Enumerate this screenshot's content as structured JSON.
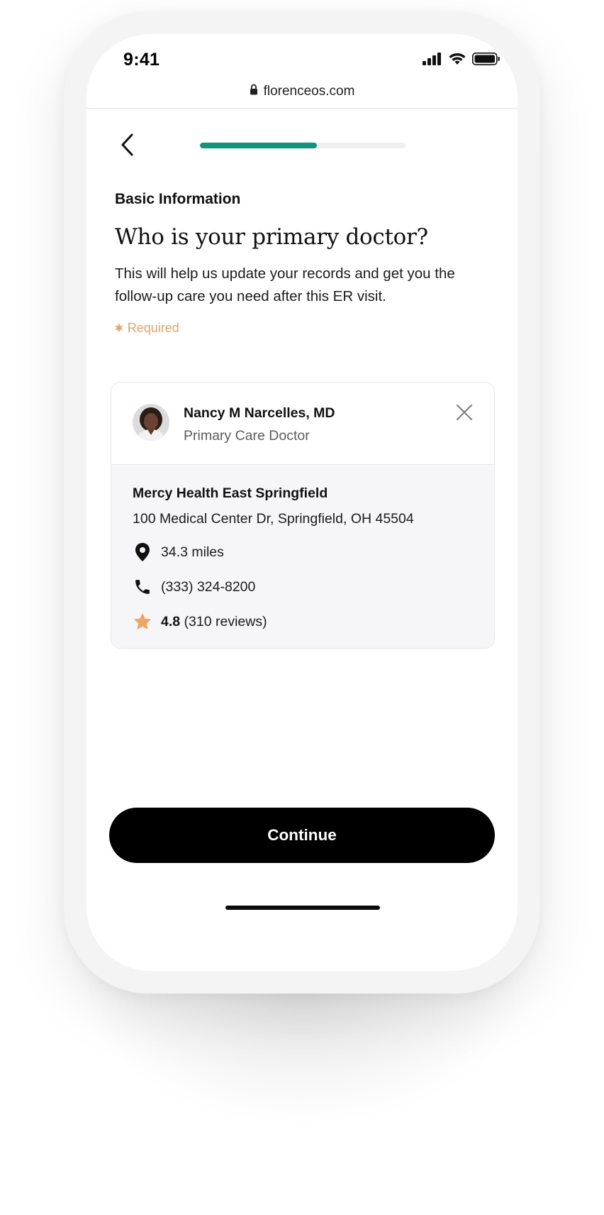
{
  "status_bar": {
    "time": "9:41",
    "icons": [
      "signal-icon",
      "wifi-icon",
      "battery-icon"
    ]
  },
  "browser": {
    "url": "florenceos.com",
    "lock_icon": "lock-icon"
  },
  "progress": {
    "fraction": 0.57,
    "accent": "#10957b"
  },
  "header": {
    "back_icon": "chevron-left-icon"
  },
  "form": {
    "section_label": "Basic Information",
    "question": "Who is your primary doctor?",
    "description": "This will help us update your records and get you the follow-up care you need after this ER visit.",
    "required_marker": "✱",
    "required_text": "Required",
    "required_color": "#e6a26b"
  },
  "doctor": {
    "name": "Nancy M Narcelles, MD",
    "specialty": "Primary Care Doctor",
    "facility": "Mercy Health East Springfield",
    "address": "100 Medical Center Dr, Springfield, OH 45504",
    "distance": "34.3 miles",
    "phone": "(333) 324-8200",
    "rating": "4.8",
    "reviews": "(310 reviews)",
    "star_color": "#f0a464"
  },
  "actions": {
    "continue_label": "Continue"
  }
}
